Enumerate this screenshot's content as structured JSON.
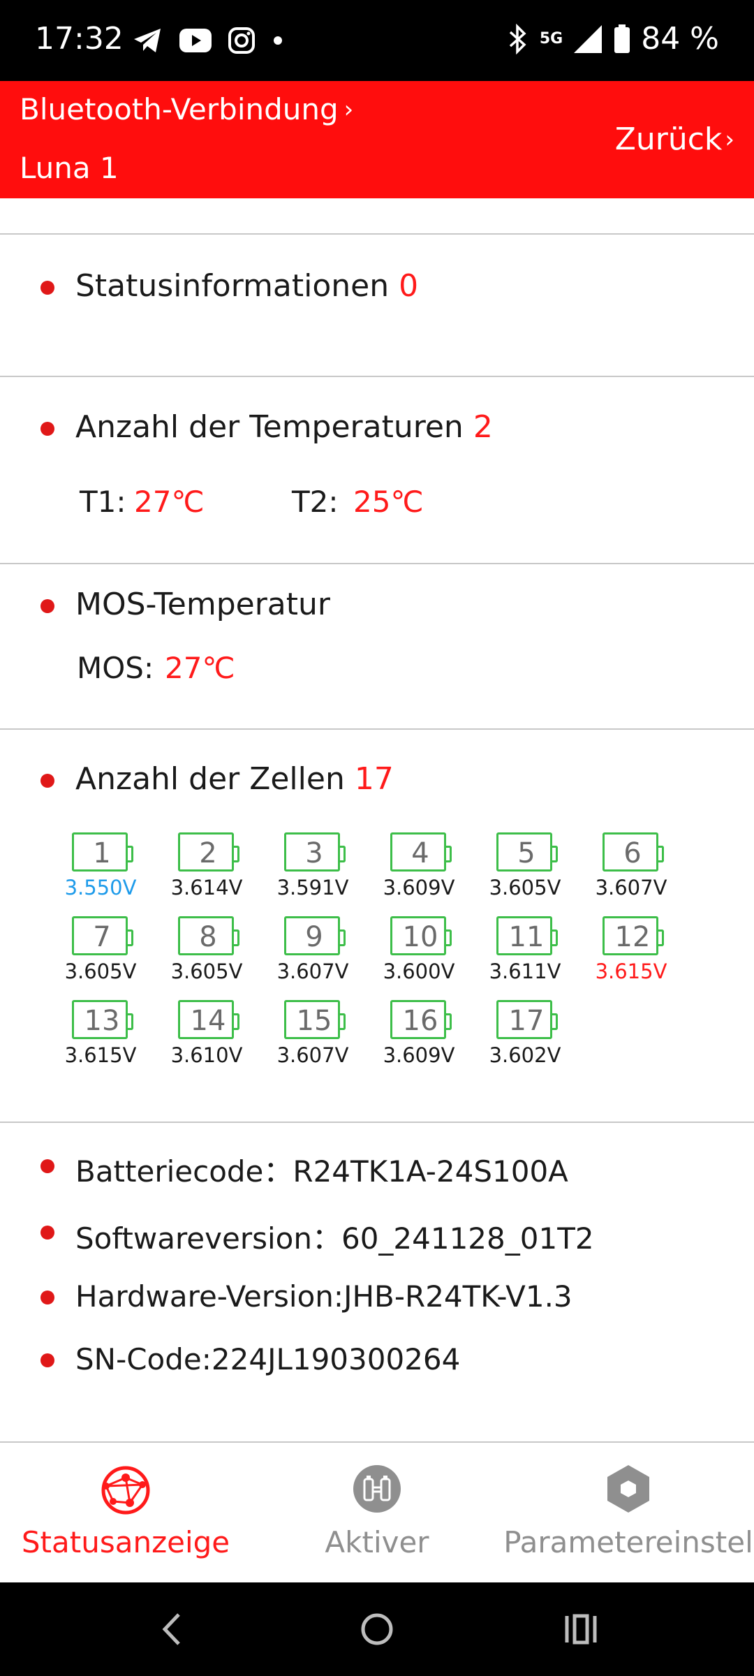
{
  "status_bar": {
    "time": "17:32",
    "apps": [
      "telegram-icon",
      "youtube-icon",
      "instagram-icon",
      "dot-icon"
    ],
    "network": "5G",
    "battery": "84 %"
  },
  "header": {
    "link": "Bluetooth-Verbindung",
    "device": "Luna 1",
    "back": "Zurück"
  },
  "status_info": {
    "label": "Statusinformationen",
    "count": "0"
  },
  "temperatures": {
    "label": "Anzahl der Temperaturen",
    "count": "2",
    "items": [
      {
        "label": "T1:",
        "value": "27℃"
      },
      {
        "label": "T2:",
        "value": "25℃"
      }
    ]
  },
  "mos": {
    "label": "MOS-Temperatur",
    "item_label": "MOS:",
    "value": "27℃"
  },
  "cells": {
    "label": "Anzahl der Zellen",
    "count": "17",
    "items": [
      {
        "n": "1",
        "v": "3.550V",
        "state": "low"
      },
      {
        "n": "2",
        "v": "3.614V",
        "state": "normal"
      },
      {
        "n": "3",
        "v": "3.591V",
        "state": "normal"
      },
      {
        "n": "4",
        "v": "3.609V",
        "state": "normal"
      },
      {
        "n": "5",
        "v": "3.605V",
        "state": "normal"
      },
      {
        "n": "6",
        "v": "3.607V",
        "state": "normal"
      },
      {
        "n": "7",
        "v": "3.605V",
        "state": "normal"
      },
      {
        "n": "8",
        "v": "3.605V",
        "state": "normal"
      },
      {
        "n": "9",
        "v": "3.607V",
        "state": "normal"
      },
      {
        "n": "10",
        "v": "3.600V",
        "state": "normal"
      },
      {
        "n": "11",
        "v": "3.611V",
        "state": "normal"
      },
      {
        "n": "12",
        "v": "3.615V",
        "state": "high"
      },
      {
        "n": "13",
        "v": "3.615V",
        "state": "normal"
      },
      {
        "n": "14",
        "v": "3.610V",
        "state": "normal"
      },
      {
        "n": "15",
        "v": "3.607V",
        "state": "normal"
      },
      {
        "n": "16",
        "v": "3.609V",
        "state": "normal"
      },
      {
        "n": "17",
        "v": "3.602V",
        "state": "normal"
      }
    ]
  },
  "info": {
    "battery_code": "Batteriecode：R24TK1A-24S100A",
    "software_version": "Softwareversion：60_241128_01T2",
    "hardware_version": "Hardware-Version:JHB-R24TK-V1.3",
    "sn_code": "SN-Code:224JL190300264"
  },
  "bottom_nav": [
    {
      "label": "Statusanzeige",
      "icon": "globe-network-icon",
      "active": true
    },
    {
      "label": "Aktiver",
      "icon": "balancer-icon",
      "active": false
    },
    {
      "label": "Parametereinstel",
      "icon": "hexagon-settings-icon",
      "active": false
    }
  ],
  "colors": {
    "accent": "#ff0d0d",
    "value_red": "#ff1a1a",
    "cell_green": "#3dbe49",
    "cell_low_blue": "#1e9bea"
  }
}
